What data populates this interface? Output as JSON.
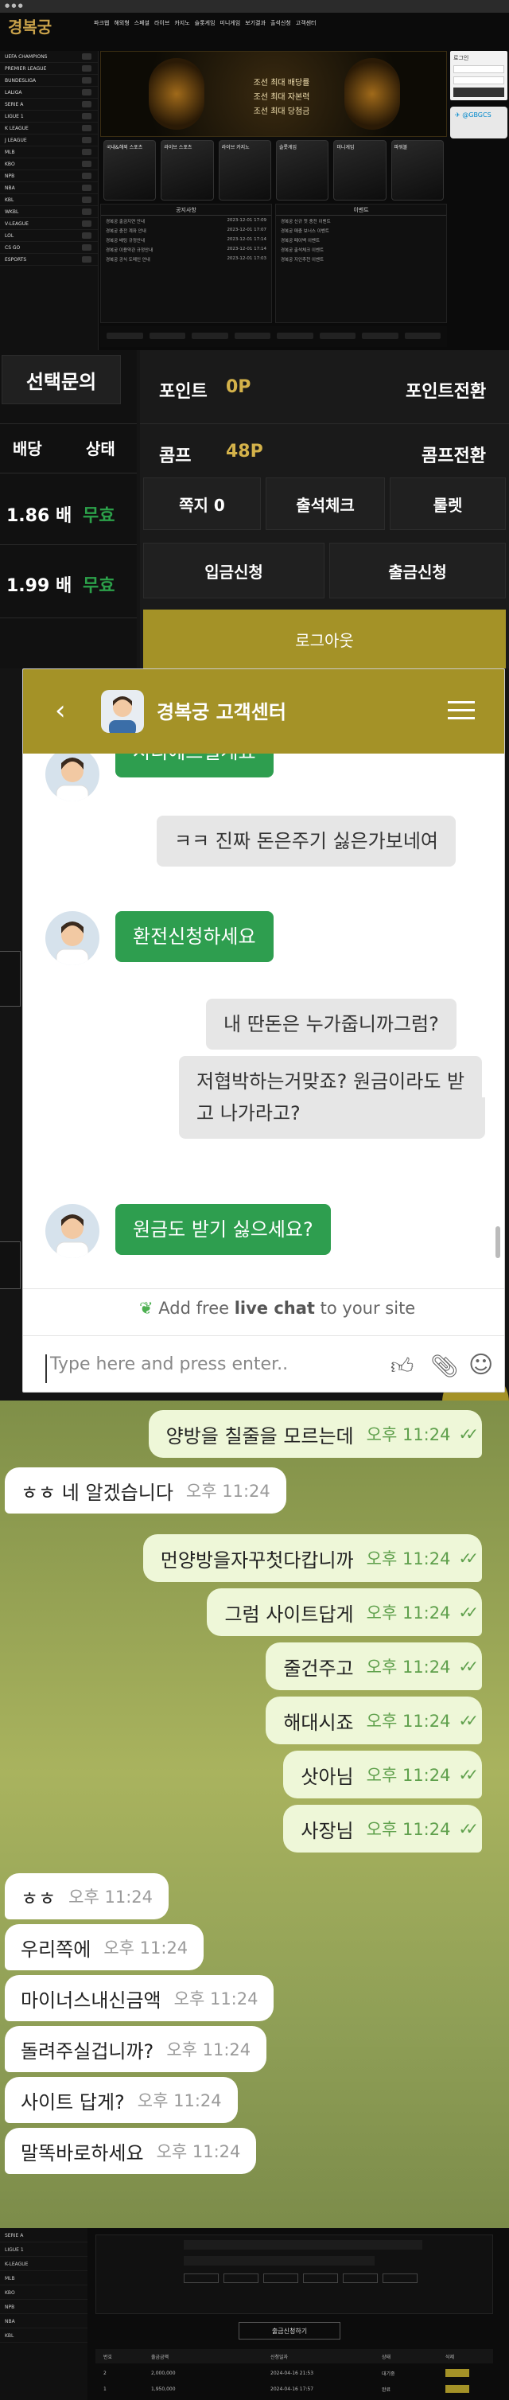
{
  "site": {
    "logo": "경복궁",
    "nav": [
      "파크웹",
      "해외형",
      "스페셜",
      "라이브",
      "카지노",
      "슬롯게임",
      "미니게임",
      "보기결과",
      "출석신청",
      "고객센터"
    ],
    "banner_lines": [
      "조선 최대 배당률",
      "조선 최대 자본력",
      "조선 최대 당첨금"
    ],
    "sidebar": [
      "UEFA CHAMPIONS",
      "PREMIER LEAGUE",
      "BUNDESLIGA",
      "LALIGA",
      "SERIE A",
      "LIGUE 1",
      "K LEAGUE",
      "J LEAGUE",
      "MLB",
      "KBO",
      "NPB",
      "NBA",
      "KBL",
      "WKBL",
      "V-LEAGUE",
      "LOL",
      "CS GO",
      "ESPORTS"
    ],
    "cards": [
      "국내&해외 스포츠",
      "라이브 스포츠",
      "라이브 카지노",
      "슬롯게임",
      "미니게임",
      "파워볼"
    ],
    "list_titles": [
      "공지사항",
      "이벤트"
    ],
    "notices": [
      "경복궁 출금지연 안내",
      "경복궁 충전 계좌 안내",
      "경복궁 배팅 규정안내",
      "경복궁 이용약관 규정안내",
      "경복궁 공식 도메인 안내"
    ],
    "notice_dates": [
      "2023-12-01 17:09",
      "2023-12-01 17:07",
      "2023-12-01 17:14",
      "2023-12-01 17:14",
      "2023-12-01 17:03"
    ],
    "events": [
      "경복궁 신규 첫 충전 이벤트",
      "경복궁 매충 보너스 이벤트",
      "경복궁 페이백 이벤트",
      "경복궁 출석체크 이벤트",
      "경복궁 지인추천 이벤트"
    ],
    "login_title": "로그인",
    "tg_handle": "@GBGCS"
  },
  "panel": {
    "inquiry": "선택문의",
    "col_odds": "배당",
    "col_status": "상태",
    "rows": [
      {
        "odds": "1.86 배",
        "status": "무효"
      },
      {
        "odds": "1.99 배",
        "status": "무효"
      }
    ],
    "point_label": "포인트",
    "point_value": "0P",
    "point_convert": "포인트전환",
    "comp_label": "콤프",
    "comp_value": "48P",
    "comp_convert": "콤프전환",
    "note": "쪽지 0",
    "attendance": "출석체크",
    "roulette": "룰렛",
    "deposit": "입금신청",
    "withdraw": "출금신청",
    "logout": "로그아웃"
  },
  "chat": {
    "title": "경복궁 고객센터",
    "messages": [
      {
        "from": "agent",
        "text": "시리에드릴게요"
      },
      {
        "from": "me",
        "text": "ㅋㅋ 진짜 돈은주기 싫은가보네여"
      },
      {
        "from": "agent",
        "text": "환전신청하세요"
      },
      {
        "from": "me",
        "text": "내 딴돈은 누가줍니까그럼?"
      },
      {
        "from": "me",
        "text": "저협박하는거맞죠? 원금이라도 받"
      },
      {
        "from": "me",
        "text": "고 나가라고?"
      },
      {
        "from": "agent",
        "text": "원금도 받기 싫으세요?"
      }
    ],
    "powered_pre": "Add free ",
    "powered_bold": "live chat",
    "powered_post": " to your site",
    "input_placeholder": "Type here and press enter.."
  },
  "telegram": {
    "messages": [
      {
        "from": "me",
        "text": "양방을 칠줄을 모르는데",
        "time": "오후 11:24"
      },
      {
        "from": "them",
        "text": "ㅎㅎ 네 알겠습니다",
        "time": "오후 11:24"
      },
      {
        "from": "me",
        "text": "먼양방을자꾸첫다캅니까",
        "time": "오후 11:24"
      },
      {
        "from": "me",
        "text": "그럼 사이트답게",
        "time": "오후 11:24"
      },
      {
        "from": "me",
        "text": "줄건주고",
        "time": "오후 11:24"
      },
      {
        "from": "me",
        "text": "해대시죠",
        "time": "오후 11:24"
      },
      {
        "from": "me",
        "text": "삿아님",
        "time": "오후 11:24"
      },
      {
        "from": "me",
        "text": "사장님",
        "time": "오후 11:24"
      },
      {
        "from": "them",
        "text": "ㅎㅎ",
        "time": "오후 11:24"
      },
      {
        "from": "them",
        "text": "우리쪽에",
        "time": "오후 11:24"
      },
      {
        "from": "them",
        "text": "마이너스내신금액",
        "time": "오후 11:24"
      },
      {
        "from": "them",
        "text": "돌려주실겁니까?",
        "time": "오후 11:24"
      },
      {
        "from": "them",
        "text": "사이트 답게?",
        "time": "오후 11:24"
      },
      {
        "from": "them",
        "text": "말똑바로하세요",
        "time": "오후 11:24"
      }
    ]
  },
  "bottom_site": {
    "sidebar": [
      "SERIE A",
      "LIGUE 1",
      "K-LEAGUE",
      "MLB",
      "KBO",
      "NPB",
      "NBA",
      "KBL"
    ],
    "withdraw_button": "출금신청하기",
    "table_headers": [
      "번호",
      "출금금액",
      "신청일자",
      "상태",
      "삭제"
    ],
    "rows": [
      {
        "no": "2",
        "amount": "2,000,000",
        "date": "2024-04-16 21:53",
        "status": "대기중"
      },
      {
        "no": "1",
        "amount": "1,950,000",
        "date": "2024-04-16 17:57",
        "status": "완료"
      }
    ]
  },
  "colors": {
    "gold": "#a49227",
    "green": "#2e9e4f",
    "telegram_out": "#eef7d8"
  }
}
